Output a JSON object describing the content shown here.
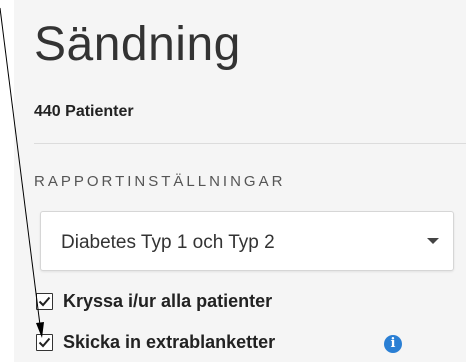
{
  "header": {
    "title": "Sändning",
    "patient_count": "440 Patienter"
  },
  "report_settings": {
    "section_label": "RAPPORTINSTÄLLNINGAR",
    "report_type": {
      "selected": "Diabetes Typ 1 och Typ 2"
    }
  },
  "options": [
    {
      "label": "Kryssa i/ur alla patienter",
      "checked": true
    },
    {
      "label": "Skicka in extrablanketter",
      "checked": true,
      "info_icon": "info-icon"
    }
  ],
  "colors": {
    "panel_background": "#f5f5f5",
    "info_icon": "#2a7fd4",
    "text_primary": "#222222",
    "divider": "#dcdcdc"
  }
}
